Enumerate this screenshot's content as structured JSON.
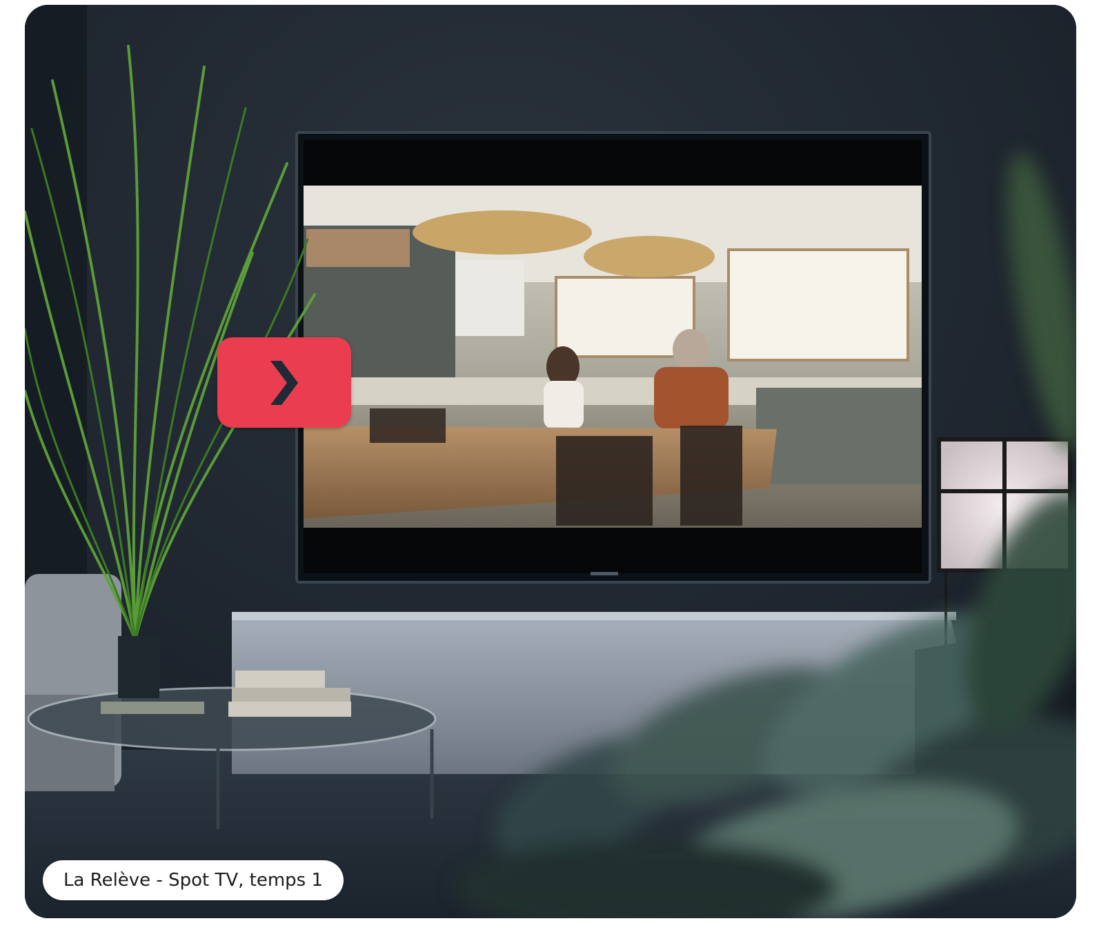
{
  "video": {
    "caption": "La Relève - Spot TV, temps 1",
    "play_icon": "chevron-right-icon"
  },
  "colors": {
    "play_button": "#ea3d50",
    "play_icon": "#1f2a36",
    "caption_bg": "#ffffff",
    "caption_text": "#1b1b1b",
    "wall": "#1b222b"
  }
}
